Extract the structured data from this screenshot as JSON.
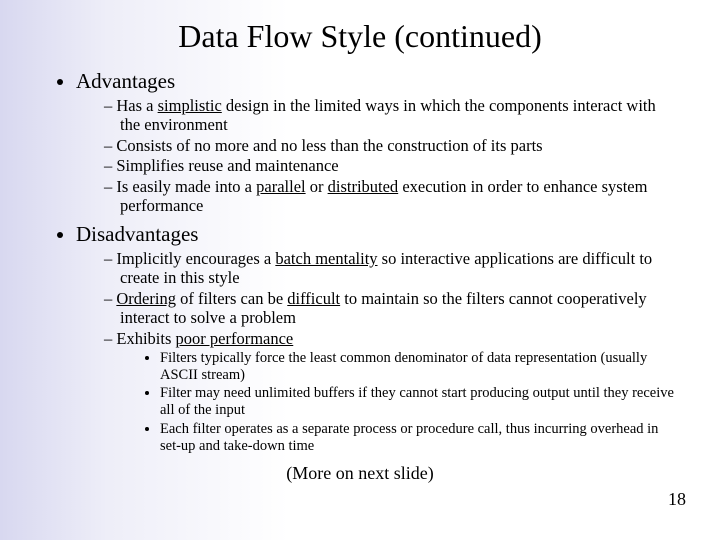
{
  "title": "Data Flow Style (continued)",
  "advantages": {
    "heading": "Advantages",
    "a1_pre": "Has a ",
    "a1_u": "simplistic",
    "a1_post": " design in the limited ways in which the components interact with the environment",
    "a2": "Consists of no more and no less than the construction of its parts",
    "a3": "Simplifies reuse and maintenance",
    "a4_pre": "Is easily made into a ",
    "a4_u1": "parallel",
    "a4_mid": " or ",
    "a4_u2": "distributed",
    "a4_post": " execution in order to enhance system performance"
  },
  "disadvantages": {
    "heading": "Disadvantages",
    "d1_pre": "Implicitly encourages a ",
    "d1_u": "batch mentality",
    "d1_post": " so interactive applications are difficult to create in this style",
    "d2_u1": "Ordering",
    "d2_mid1": " of filters can be ",
    "d2_u2": "difficult",
    "d2_post": " to maintain so the filters cannot cooperatively interact to solve a problem",
    "d3_pre": "Exhibits ",
    "d3_u": "poor performance",
    "sub1": "Filters typically force the least common denominator of data representation (usually ASCII stream)",
    "sub2": "Filter may need unlimited buffers if they cannot start producing output until they receive all of the input",
    "sub3": "Each filter operates as a separate process or procedure call, thus incurring overhead in set-up and take-down time"
  },
  "more": "(More on next slide)",
  "pagenum": "18"
}
